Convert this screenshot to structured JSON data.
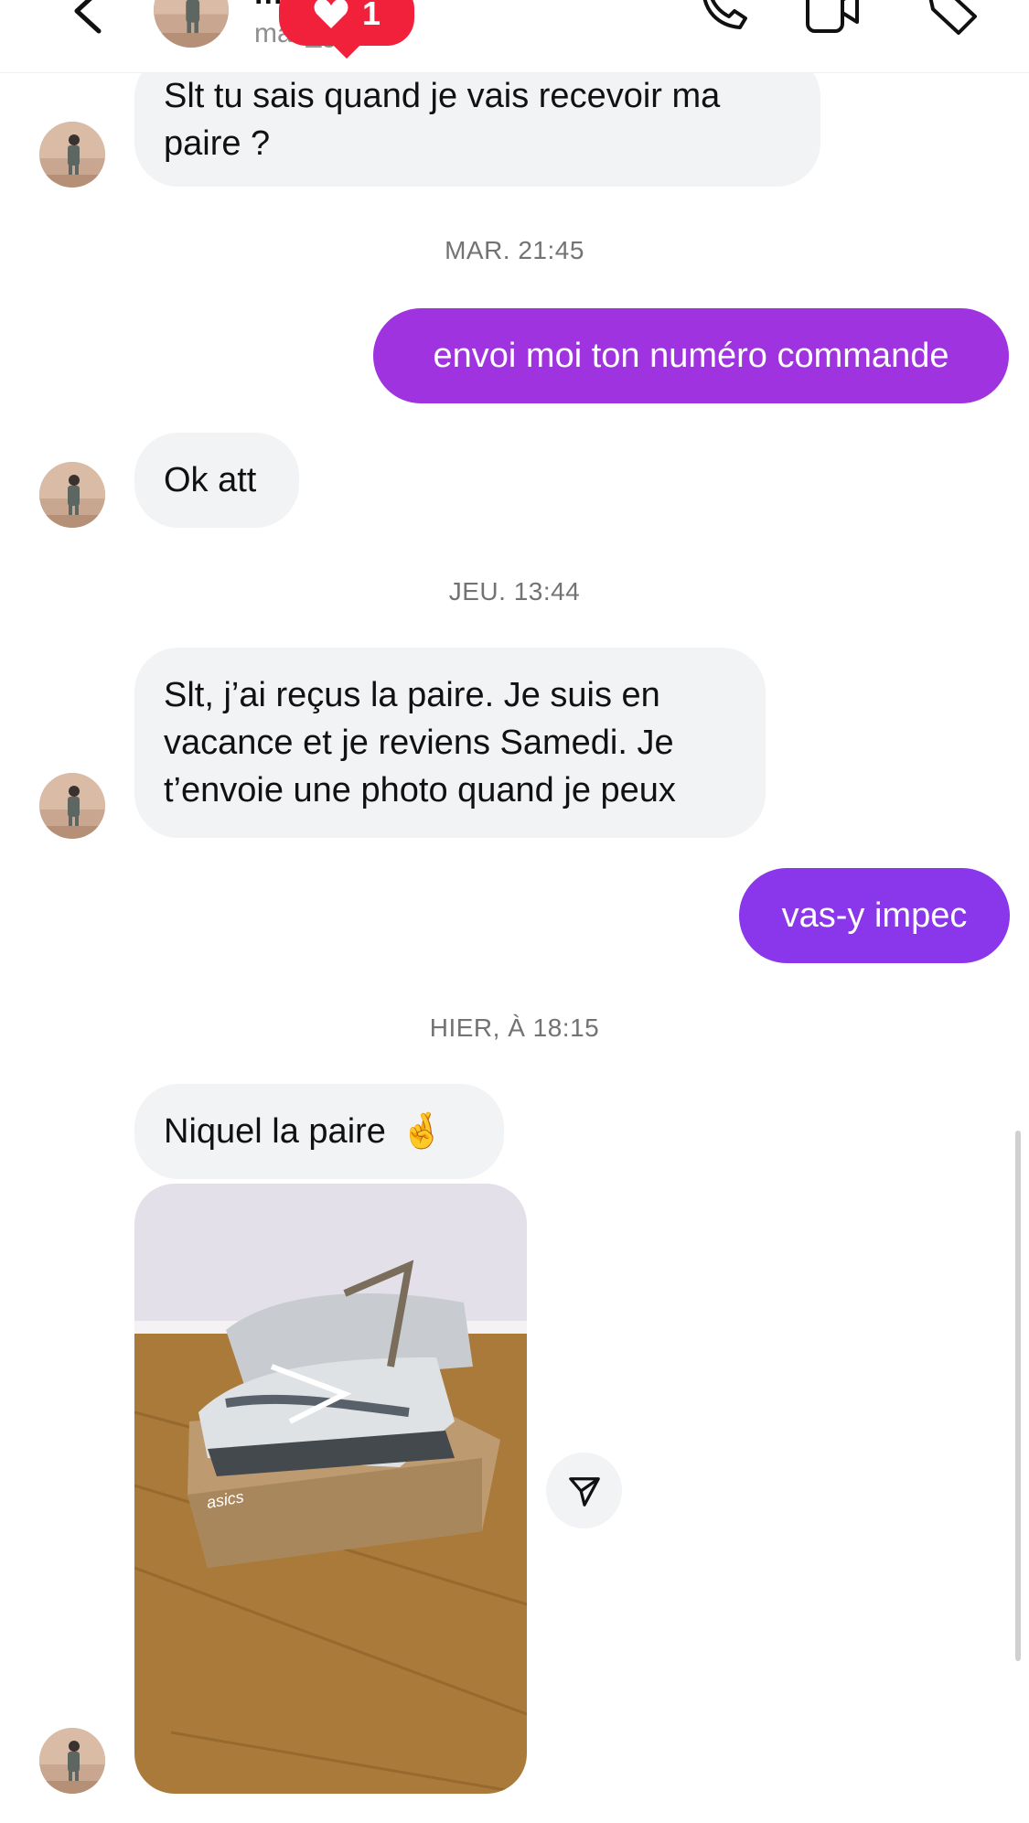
{
  "header": {
    "name": "m_glck",
    "username": "max_glck",
    "like_count": "1",
    "icons": [
      "back-chevron-icon",
      "phone-icon",
      "video-icon",
      "tag-icon"
    ]
  },
  "messages": [
    {
      "side": "in",
      "text": "Slt tu sais quand je vais recevoir ma\npaire ?"
    },
    {
      "type": "timestamp",
      "text": "MAR. 21:45"
    },
    {
      "side": "out",
      "text": "envoi moi ton numéro commande"
    },
    {
      "side": "in",
      "text": "Ok att"
    },
    {
      "type": "timestamp",
      "text": "JEU. 13:44"
    },
    {
      "side": "in",
      "text": "Slt, j’ai reçus la paire. Je suis en\nvacance et je reviens Samedi. Je\nt’envoie une photo quand je peux"
    },
    {
      "side": "out",
      "text": "vas-y impec"
    },
    {
      "type": "timestamp",
      "text": "HIER, À 18:15"
    },
    {
      "side": "in",
      "text": "Niquel la paire",
      "emoji": "🤞"
    },
    {
      "side": "in",
      "type": "photo",
      "photo_brand": "asics",
      "icon": "share-icon"
    }
  ],
  "colors": {
    "outgoing_1": "#a033e0",
    "outgoing_2": "#8a36ea",
    "incoming": "#f2f3f5",
    "like": "#f2213b",
    "timestamp": "#737373"
  }
}
